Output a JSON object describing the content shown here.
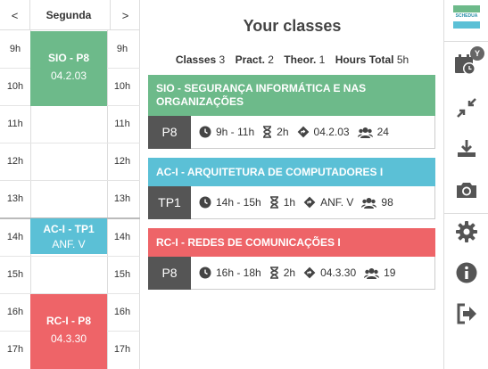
{
  "schedule": {
    "prev_label": "<",
    "next_label": ">",
    "day": "Segunda",
    "hours": [
      "9h",
      "10h",
      "11h",
      "12h",
      "13h",
      "14h",
      "15h",
      "16h",
      "17h"
    ],
    "blocks": [
      {
        "title": "SIO - P8",
        "room": "04.2.03"
      },
      {
        "title": "AC-I - TP1",
        "room": "ANF. V"
      },
      {
        "title": "RC-I - P8",
        "room": "04.3.30"
      }
    ]
  },
  "main": {
    "title": "Your classes",
    "stats": {
      "classes_label": "Classes",
      "classes_value": "3",
      "pract_label": "Pract.",
      "pract_value": "2",
      "theor_label": "Theor.",
      "theor_value": "1",
      "hours_label": "Hours Total",
      "hours_value": "5h"
    },
    "classes": [
      {
        "name": "SIO - SEGURANÇA INFORMÁTICA E NAS ORGANIZAÇÕES",
        "type": "P8",
        "time": "9h - 11h",
        "duration": "2h",
        "room": "04.2.03",
        "students": "24",
        "color": "#6dba8a"
      },
      {
        "name": "AC-I - ARQUITETURA DE COMPUTADORES I",
        "type": "TP1",
        "time": "14h - 15h",
        "duration": "1h",
        "room": "ANF. V",
        "students": "98",
        "color": "#5bc0d6"
      },
      {
        "name": "RC-I - REDES DE COMUNICAÇÕES I",
        "type": "P8",
        "time": "16h - 18h",
        "duration": "2h",
        "room": "04.3.30",
        "students": "19",
        "color": "#ee6468"
      }
    ]
  },
  "toolbar": {
    "logo_text": "SCHEDUA",
    "badge": "Y",
    "icons": [
      "schedule-clock-icon",
      "shrink-arrows-icon",
      "download-icon",
      "camera-icon",
      "gear-icon",
      "info-icon",
      "logout-icon"
    ]
  },
  "colors": {
    "green": "#6dba8a",
    "blue": "#5bc0d6",
    "red": "#ee6468",
    "type_box": "#555555"
  }
}
